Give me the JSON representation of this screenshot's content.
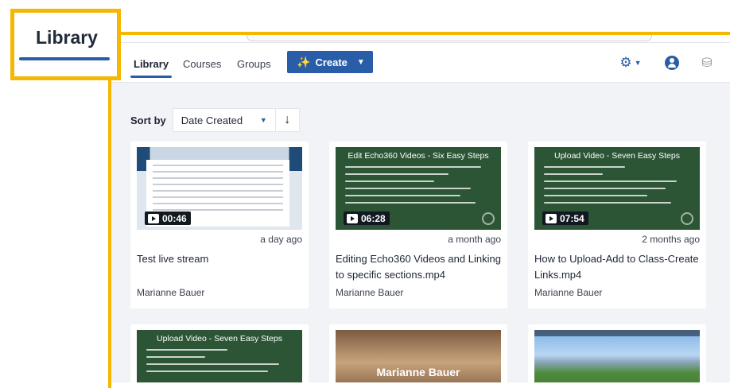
{
  "callout": {
    "label": "Library"
  },
  "nav": {
    "tabs": [
      {
        "label": "Library"
      },
      {
        "label": "Courses"
      },
      {
        "label": "Groups"
      }
    ],
    "create_label": "Create",
    "icons": {
      "settings": "gear-icon",
      "user": "user-circle-icon",
      "logo": "echo360-logo-icon"
    }
  },
  "sort": {
    "label": "Sort by",
    "selected": "Date Created",
    "direction_icon": "arrow-down-icon"
  },
  "cards": [
    {
      "thumb_type": "screen",
      "duration": "00:46",
      "age": "a day ago",
      "title": "Test live stream",
      "owner": "Marianne Bauer"
    },
    {
      "thumb_type": "green",
      "slide_title": "Edit Echo360 Videos - Six Easy Steps",
      "duration": "06:28",
      "age": "a month ago",
      "title": "Editing Echo360 Videos and Linking to specific sections.mp4",
      "owner": "Marianne Bauer"
    },
    {
      "thumb_type": "green",
      "slide_title": "Upload Video - Seven Easy Steps",
      "duration": "07:54",
      "age": "2 months ago",
      "title": "How to Upload-Add to Class-Create Links.mp4",
      "owner": "Marianne Bauer"
    },
    {
      "thumb_type": "green",
      "slide_title": "Upload Video - Seven Easy Steps"
    },
    {
      "thumb_type": "brown",
      "overlay_text": "Marianne Bauer"
    },
    {
      "thumb_type": "landscape"
    }
  ],
  "colors": {
    "accent": "#2a5da8",
    "callout": "#f5b800",
    "slide_green": "#2c5536"
  }
}
